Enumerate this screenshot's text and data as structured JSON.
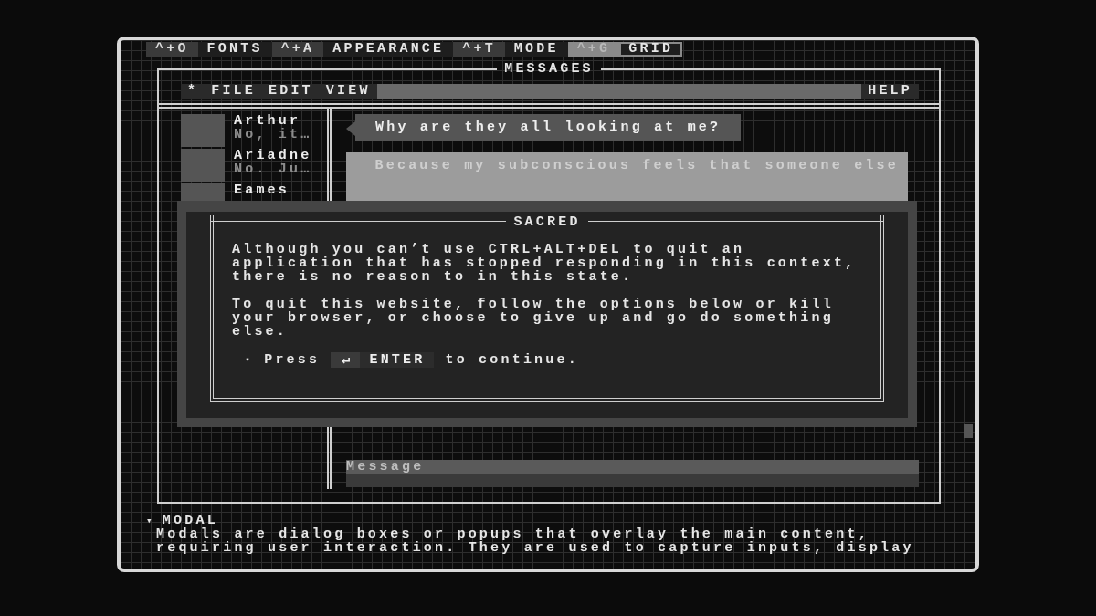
{
  "top_menu": [
    {
      "key": "^+O",
      "label": "FONTS",
      "selected": false
    },
    {
      "key": "^+A",
      "label": "APPEARANCE",
      "selected": false
    },
    {
      "key": "^+T",
      "label": "MODE",
      "selected": false
    },
    {
      "key": "^+G",
      "label": "GRID",
      "selected": true
    }
  ],
  "window": {
    "title": "MESSAGES"
  },
  "menu_bar": {
    "left": [
      "*",
      "FILE",
      "EDIT",
      "VIEW"
    ],
    "right": [
      "HELP"
    ]
  },
  "contacts": [
    {
      "name": "Arthur",
      "preview": "No, it…"
    },
    {
      "name": "Ariadne",
      "preview": "No. Ju…"
    },
    {
      "name": "Eames"
    }
  ],
  "messages": [
    {
      "kind": "received",
      "lines": [
        "Why are they all looking at me?"
      ]
    },
    {
      "kind": "sent",
      "lines": [
        "Because my subconscious feels that someone else"
      ]
    }
  ],
  "message_field": {
    "placeholder": "Message"
  },
  "modal": {
    "title": "SACRED",
    "paragraphs": [
      "Although you can’t use CTRL+ALT+DEL to quit an application that has stopped responding in this context, there is no reason to in this state.",
      "To quit this website, follow the options below or kill your browser, or choose to give up and go do something else."
    ],
    "prompt": {
      "bullet": "▪",
      "before": "Press",
      "key_icon": "↵",
      "key": "ENTER",
      "after": "to continue."
    }
  },
  "info": {
    "marker": "▾",
    "title": "MODAL",
    "expanded": true,
    "text": "Modals are dialog boxes or popups that overlay the main content, requiring user interaction. They are used to capture inputs, display"
  }
}
